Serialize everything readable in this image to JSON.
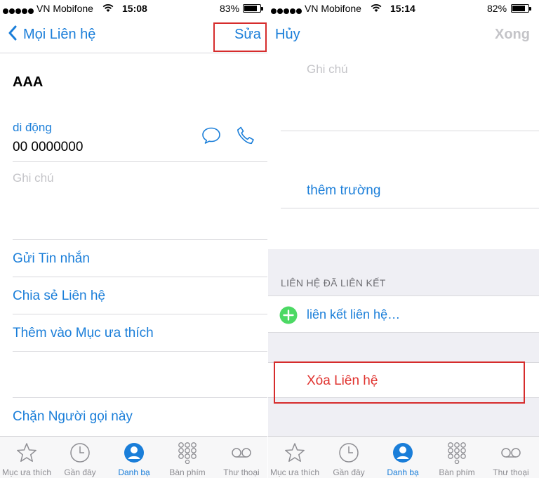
{
  "left": {
    "status": {
      "carrier": "VN Mobifone",
      "time": "15:08",
      "battery": "83%",
      "battery_level": 0.83
    },
    "nav": {
      "back_label": "Mọi Liên hệ",
      "edit_label": "Sửa"
    },
    "contact": {
      "name": "AAA",
      "phone_label": "di động",
      "phone_value": "00 0000000",
      "notes_placeholder": "Ghi chú"
    },
    "actions": {
      "send_message": "Gửi Tin nhắn",
      "share_contact": "Chia sẻ Liên hệ",
      "add_favorite": "Thêm vào Mục ưa thích",
      "block_caller": "Chặn Người gọi này"
    }
  },
  "right": {
    "status": {
      "carrier": "VN Mobifone",
      "time": "15:14",
      "battery": "82%",
      "battery_level": 0.82
    },
    "nav": {
      "cancel_label": "Hủy",
      "done_label": "Xong"
    },
    "notes_placeholder": "Ghi chú",
    "add_field": "thêm trường",
    "linked_header": "LIÊN HỆ ĐÃ LIÊN KẾT",
    "link_contact": "liên kết liên hệ…",
    "delete_contact": "Xóa Liên hệ"
  },
  "tabs": [
    {
      "label": "Mục ưa thích",
      "icon": "star-icon"
    },
    {
      "label": "Gần đây",
      "icon": "clock-icon"
    },
    {
      "label": "Danh bạ",
      "icon": "contacts-icon"
    },
    {
      "label": "Bàn phím",
      "icon": "keypad-icon"
    },
    {
      "label": "Thư thoại",
      "icon": "voicemail-icon"
    }
  ],
  "colors": {
    "accent": "#1a7ed9",
    "destructive": "#e0322e",
    "highlight": "#d62c2c",
    "add_green": "#4cd964",
    "placeholder": "#c4c4c8"
  }
}
